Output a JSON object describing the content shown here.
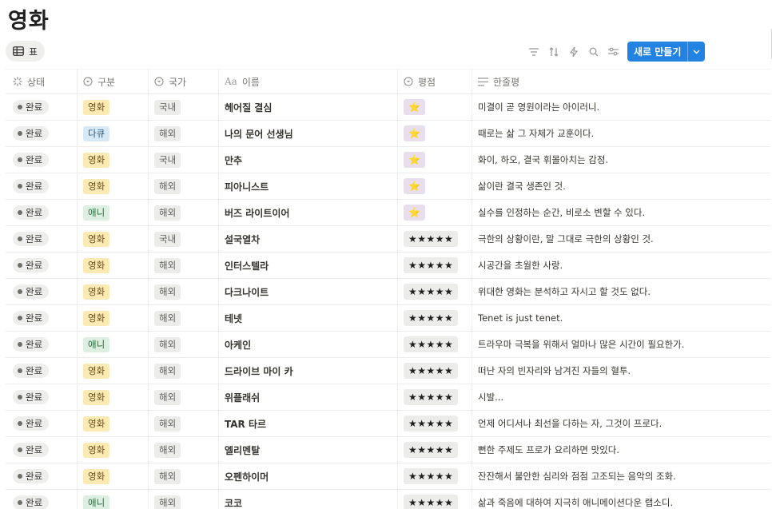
{
  "page": {
    "title": "영화"
  },
  "view": {
    "label": "표",
    "icon": "table-icon"
  },
  "toolbar": {
    "icons": [
      "filter-icon",
      "sort-icon",
      "automation-icon",
      "search-icon",
      "settings-icon"
    ],
    "new_button_label": "새로 만들기"
  },
  "columns": {
    "status": "상태",
    "kind": "구분",
    "country": "국가",
    "name": "이름",
    "rating": "평점",
    "review": "한줄평"
  },
  "colors": {
    "accent": "#2383e2",
    "tag_movie": "#fbeab4",
    "tag_docu": "#d8e9f6",
    "tag_anime": "#dcefe1",
    "tag_country": "#ececea",
    "rating_star_bg": "#e8deee",
    "rating_five_bg": "#ececea"
  },
  "rows": [
    {
      "status": "완료",
      "kind": "영화",
      "kind_color": "yellow",
      "country": "국내",
      "name": "헤어질 결심",
      "rating": "⭐",
      "rating_style": "purple",
      "review": "미결이 곧 영원이라는 아이러니."
    },
    {
      "status": "완료",
      "kind": "다큐",
      "kind_color": "blue",
      "country": "해외",
      "name": "나의 문어 선생님",
      "rating": "⭐",
      "rating_style": "purple",
      "review": "때로는 삶 그 자체가 교훈이다."
    },
    {
      "status": "완료",
      "kind": "영화",
      "kind_color": "yellow",
      "country": "국내",
      "name": "만추",
      "rating": "⭐",
      "rating_style": "purple",
      "review": "화이, 하오, 결국 휘몰아치는 감정."
    },
    {
      "status": "완료",
      "kind": "영화",
      "kind_color": "yellow",
      "country": "해외",
      "name": "피아니스트",
      "rating": "⭐",
      "rating_style": "purple",
      "review": "삶이란 결국 생존인 것."
    },
    {
      "status": "완료",
      "kind": "애니",
      "kind_color": "green",
      "country": "해외",
      "name": "버즈 라이트이어",
      "rating": "⭐",
      "rating_style": "purple",
      "review": "실수를 인정하는 순간, 비로소 변할 수 있다."
    },
    {
      "status": "완료",
      "kind": "영화",
      "kind_color": "yellow",
      "country": "국내",
      "name": "설국열차",
      "rating": "★★★★★",
      "rating_style": "gray",
      "review": "극한의 상황이란, 말 그대로 극한의 상황인 것."
    },
    {
      "status": "완료",
      "kind": "영화",
      "kind_color": "yellow",
      "country": "해외",
      "name": "인터스텔라",
      "rating": "★★★★★",
      "rating_style": "gray",
      "review": "시공간을 초월한 사랑."
    },
    {
      "status": "완료",
      "kind": "영화",
      "kind_color": "yellow",
      "country": "해외",
      "name": "다크나이트",
      "rating": "★★★★★",
      "rating_style": "gray",
      "review": "위대한 영화는 분석하고 자시고 할 것도 없다."
    },
    {
      "status": "완료",
      "kind": "영화",
      "kind_color": "yellow",
      "country": "해외",
      "name": "테넷",
      "rating": "★★★★★",
      "rating_style": "gray",
      "review": "Tenet is just tenet."
    },
    {
      "status": "완료",
      "kind": "애니",
      "kind_color": "green",
      "country": "해외",
      "name": "아케인",
      "rating": "★★★★★",
      "rating_style": "gray",
      "review": "트라우마 극복을 위해서 얼마나 많은 시간이 필요한가."
    },
    {
      "status": "완료",
      "kind": "영화",
      "kind_color": "yellow",
      "country": "해외",
      "name": "드라이브 마이 카",
      "rating": "★★★★★",
      "rating_style": "gray",
      "review": "떠난 자의 빈자리와 남겨진 자들의 혈투."
    },
    {
      "status": "완료",
      "kind": "영화",
      "kind_color": "yellow",
      "country": "해외",
      "name": "위플래쉬",
      "rating": "★★★★★",
      "rating_style": "gray",
      "review": "시발..."
    },
    {
      "status": "완료",
      "kind": "영화",
      "kind_color": "yellow",
      "country": "해외",
      "name": "TAR 타르",
      "rating": "★★★★★",
      "rating_style": "gray",
      "review": "언제 어디서나 최선을 다하는 자, 그것이 프로다."
    },
    {
      "status": "완료",
      "kind": "영화",
      "kind_color": "yellow",
      "country": "해외",
      "name": "엘리멘탈",
      "rating": "★★★★★",
      "rating_style": "gray",
      "review": "뻔한 주제도 프로가 요리하면 맛있다."
    },
    {
      "status": "완료",
      "kind": "영화",
      "kind_color": "yellow",
      "country": "해외",
      "name": "오펜하이머",
      "rating": "★★★★★",
      "rating_style": "gray",
      "review": "잔잔해서 불안한 심리와 점점 고조되는 음악의 조화."
    },
    {
      "status": "완료",
      "kind": "애니",
      "kind_color": "green",
      "country": "해외",
      "name": "코코",
      "rating": "★★★★★",
      "rating_style": "gray",
      "review": "삶과 죽음에 대하여 지극히 애니메이션다운 랩소디."
    }
  ]
}
